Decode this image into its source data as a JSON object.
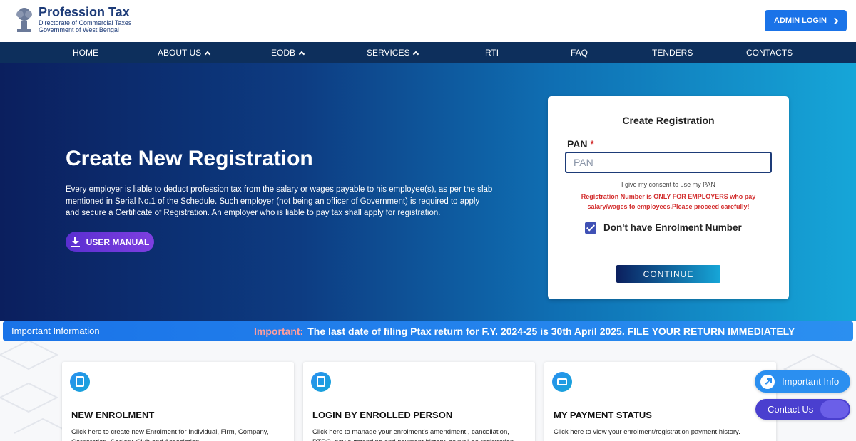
{
  "header": {
    "title": "Profession Tax",
    "subtitle1": "Directorate of Commercial Taxes",
    "subtitle2": "Government of West Bengal",
    "admin_login": "ADMIN LOGIN"
  },
  "nav": {
    "items": [
      {
        "label": "HOME",
        "has_dropdown": false
      },
      {
        "label": "ABOUT US",
        "has_dropdown": true
      },
      {
        "label": "EODB",
        "has_dropdown": true
      },
      {
        "label": "SERVICES",
        "has_dropdown": true
      },
      {
        "label": "RTI",
        "has_dropdown": false
      },
      {
        "label": "FAQ",
        "has_dropdown": false
      },
      {
        "label": "TENDERS",
        "has_dropdown": false
      },
      {
        "label": "CONTACTS",
        "has_dropdown": false
      }
    ]
  },
  "hero": {
    "title": "Create New Registration",
    "description": "Every employer is liable to deduct profession tax from the salary or wages payable to his employee(s), as per the slab mentioned in Serial No.1 of the Schedule. Such employer (not being an officer of Government) is required to apply and secure a Certificate of Registration. An employer who is liable to pay tax shall apply for registration.",
    "manual_button": "USER MANUAL"
  },
  "registration_form": {
    "title": "Create Registration",
    "pan_label": "PAN",
    "required_marker": "*",
    "pan_placeholder": "PAN",
    "pan_value": "",
    "consent_text": "I give my consent to use my PAN",
    "warning": "Registration Number is ONLY FOR EMPLOYERS who pay salary/wages to employees.Please proceed carefully!",
    "checkbox_label": "Don't have Enrolment Number",
    "checkbox_checked": true,
    "continue_button": "CONTINUE"
  },
  "ticker": {
    "label": "Important Information",
    "prefix": "Important:",
    "message": "The last date of filing Ptax return for F.Y. 2024-25 is 30th April 2025. FILE YOUR RETURN IMMEDIATELY"
  },
  "services": [
    {
      "title": "NEW ENROLMENT",
      "description": "Click here to create new Enrolment for Individual, Firm, Company, Corporation, Society, Club and Association.",
      "icon": "edit-document-icon"
    },
    {
      "title": "LOGIN BY ENROLLED PERSON",
      "description": "Click here to manage your enrolment's amendment , cancellation, PTRC, pay outstanding and payment history, as well as registration",
      "icon": "document-icon"
    },
    {
      "title": "MY PAYMENT STATUS",
      "description": "Click here to view your enrolment/registration payment history.",
      "icon": "payment-card-icon"
    }
  ],
  "floating": {
    "important_info": "Important Info",
    "contact_us": "Contact Us"
  },
  "colors": {
    "nav_bg": "#0d2f5c",
    "brand": "#1d3b78",
    "primary": "#1a73e8",
    "warning": "#d32f2f",
    "contact": "#4a3fcf"
  }
}
